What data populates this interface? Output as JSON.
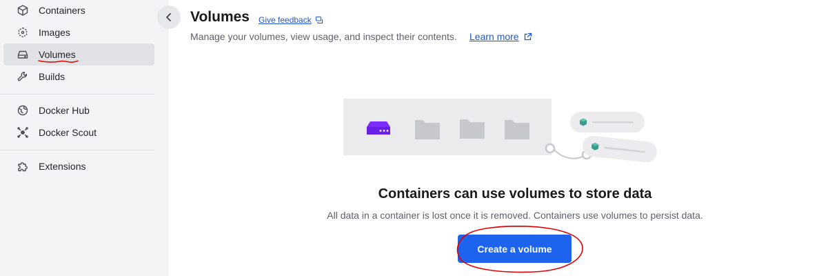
{
  "sidebar": {
    "items": [
      {
        "label": "Containers",
        "icon": "cube-icon"
      },
      {
        "label": "Images",
        "icon": "images-icon"
      },
      {
        "label": "Volumes",
        "icon": "volume-drive-icon",
        "active": true
      },
      {
        "label": "Builds",
        "icon": "wrench-icon"
      },
      {
        "label": "Docker Hub",
        "icon": "docker-hub-icon"
      },
      {
        "label": "Docker Scout",
        "icon": "docker-scout-icon"
      },
      {
        "label": "Extensions",
        "icon": "puzzle-icon"
      }
    ]
  },
  "header": {
    "title": "Volumes",
    "feedback_label": "Give feedback",
    "subtitle": "Manage your volumes, view usage, and inspect their contents.",
    "learn_more_label": "Learn more"
  },
  "empty_state": {
    "title": "Containers can use volumes to store data",
    "description": "All data in a container is lost once it is removed. Containers use volumes to persist data.",
    "button_label": "Create a volume"
  },
  "colors": {
    "accent": "#1d63ed",
    "link": "#1f58c9",
    "volume_purple": "#7d2eff",
    "container_teal": "#3a9d8c",
    "annotation_red": "#e00000"
  }
}
